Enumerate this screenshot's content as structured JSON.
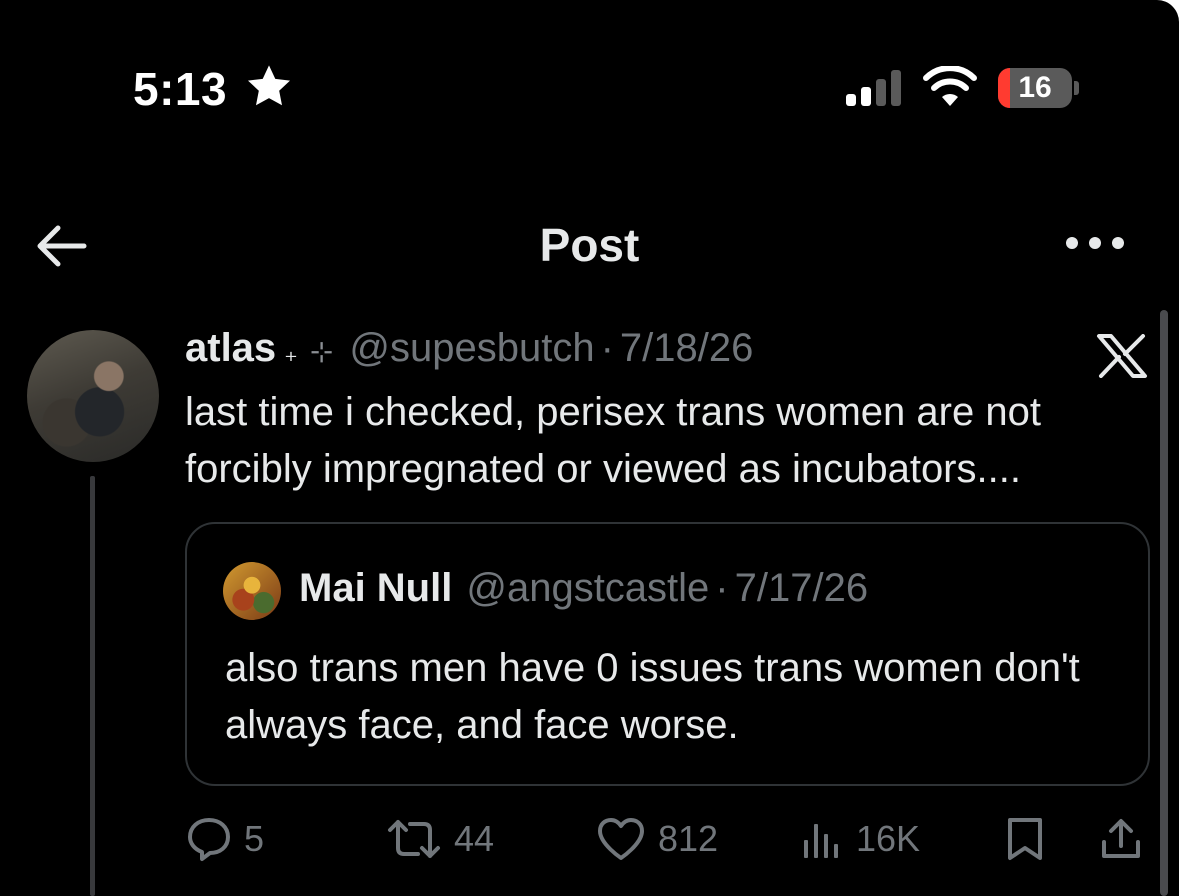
{
  "status_bar": {
    "time": "5:13",
    "battery_percent": "16",
    "battery_level": 0.16,
    "signal_bars_active": 2,
    "signal_bars_total": 4,
    "icons": [
      "star-icon",
      "cellular-signal-icon",
      "wifi-icon",
      "battery-icon"
    ]
  },
  "nav": {
    "title": "Post",
    "back_icon": "arrow-left-icon",
    "more_icon": "more-horizontal-icon"
  },
  "post": {
    "author_name": "atlas",
    "name_mark": "₊",
    "name_sparkle": "⊹",
    "handle": "@supesbutch",
    "separator": "·",
    "date": "7/18/26",
    "text": "last time i checked, perisex trans women are not forcibly impregnated or viewed as incubators....",
    "platform_icon": "x-logo-icon",
    "quote": {
      "author_name": "Mai Null",
      "handle": "@angstcastle",
      "separator": "·",
      "date": "7/17/26",
      "text": "also trans men have 0 issues trans women don't always face, and face worse."
    },
    "actions": {
      "replies": "5",
      "reposts": "44",
      "likes": "812",
      "views": "16K"
    }
  },
  "colors": {
    "background": "#000000",
    "text_primary": "#e7e9ea",
    "text_secondary": "#71767b",
    "border": "#2f3336",
    "battery_low": "#ff3b30"
  }
}
